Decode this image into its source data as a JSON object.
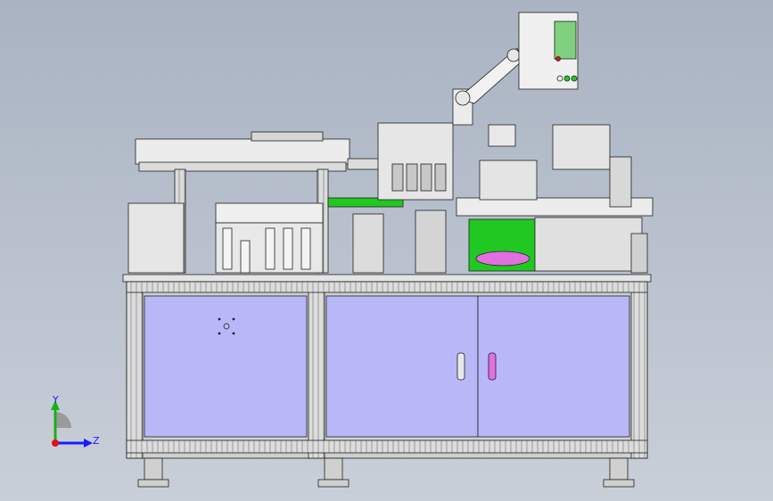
{
  "viewport": {
    "background_top": "#aab3c2",
    "background_bottom": "#c9cfd8"
  },
  "triad": {
    "y_label": "Y",
    "z_label": "Z",
    "y_color": "#18b018",
    "z_color": "#1a1aff",
    "x_color": "#e01010"
  },
  "colors": {
    "frame": "#d8d8d8",
    "panel": "#b8b8f8",
    "green_part": "#22c822",
    "magenta_part": "#e070e0",
    "screen": "#7fd07f",
    "outline": "#202020"
  }
}
